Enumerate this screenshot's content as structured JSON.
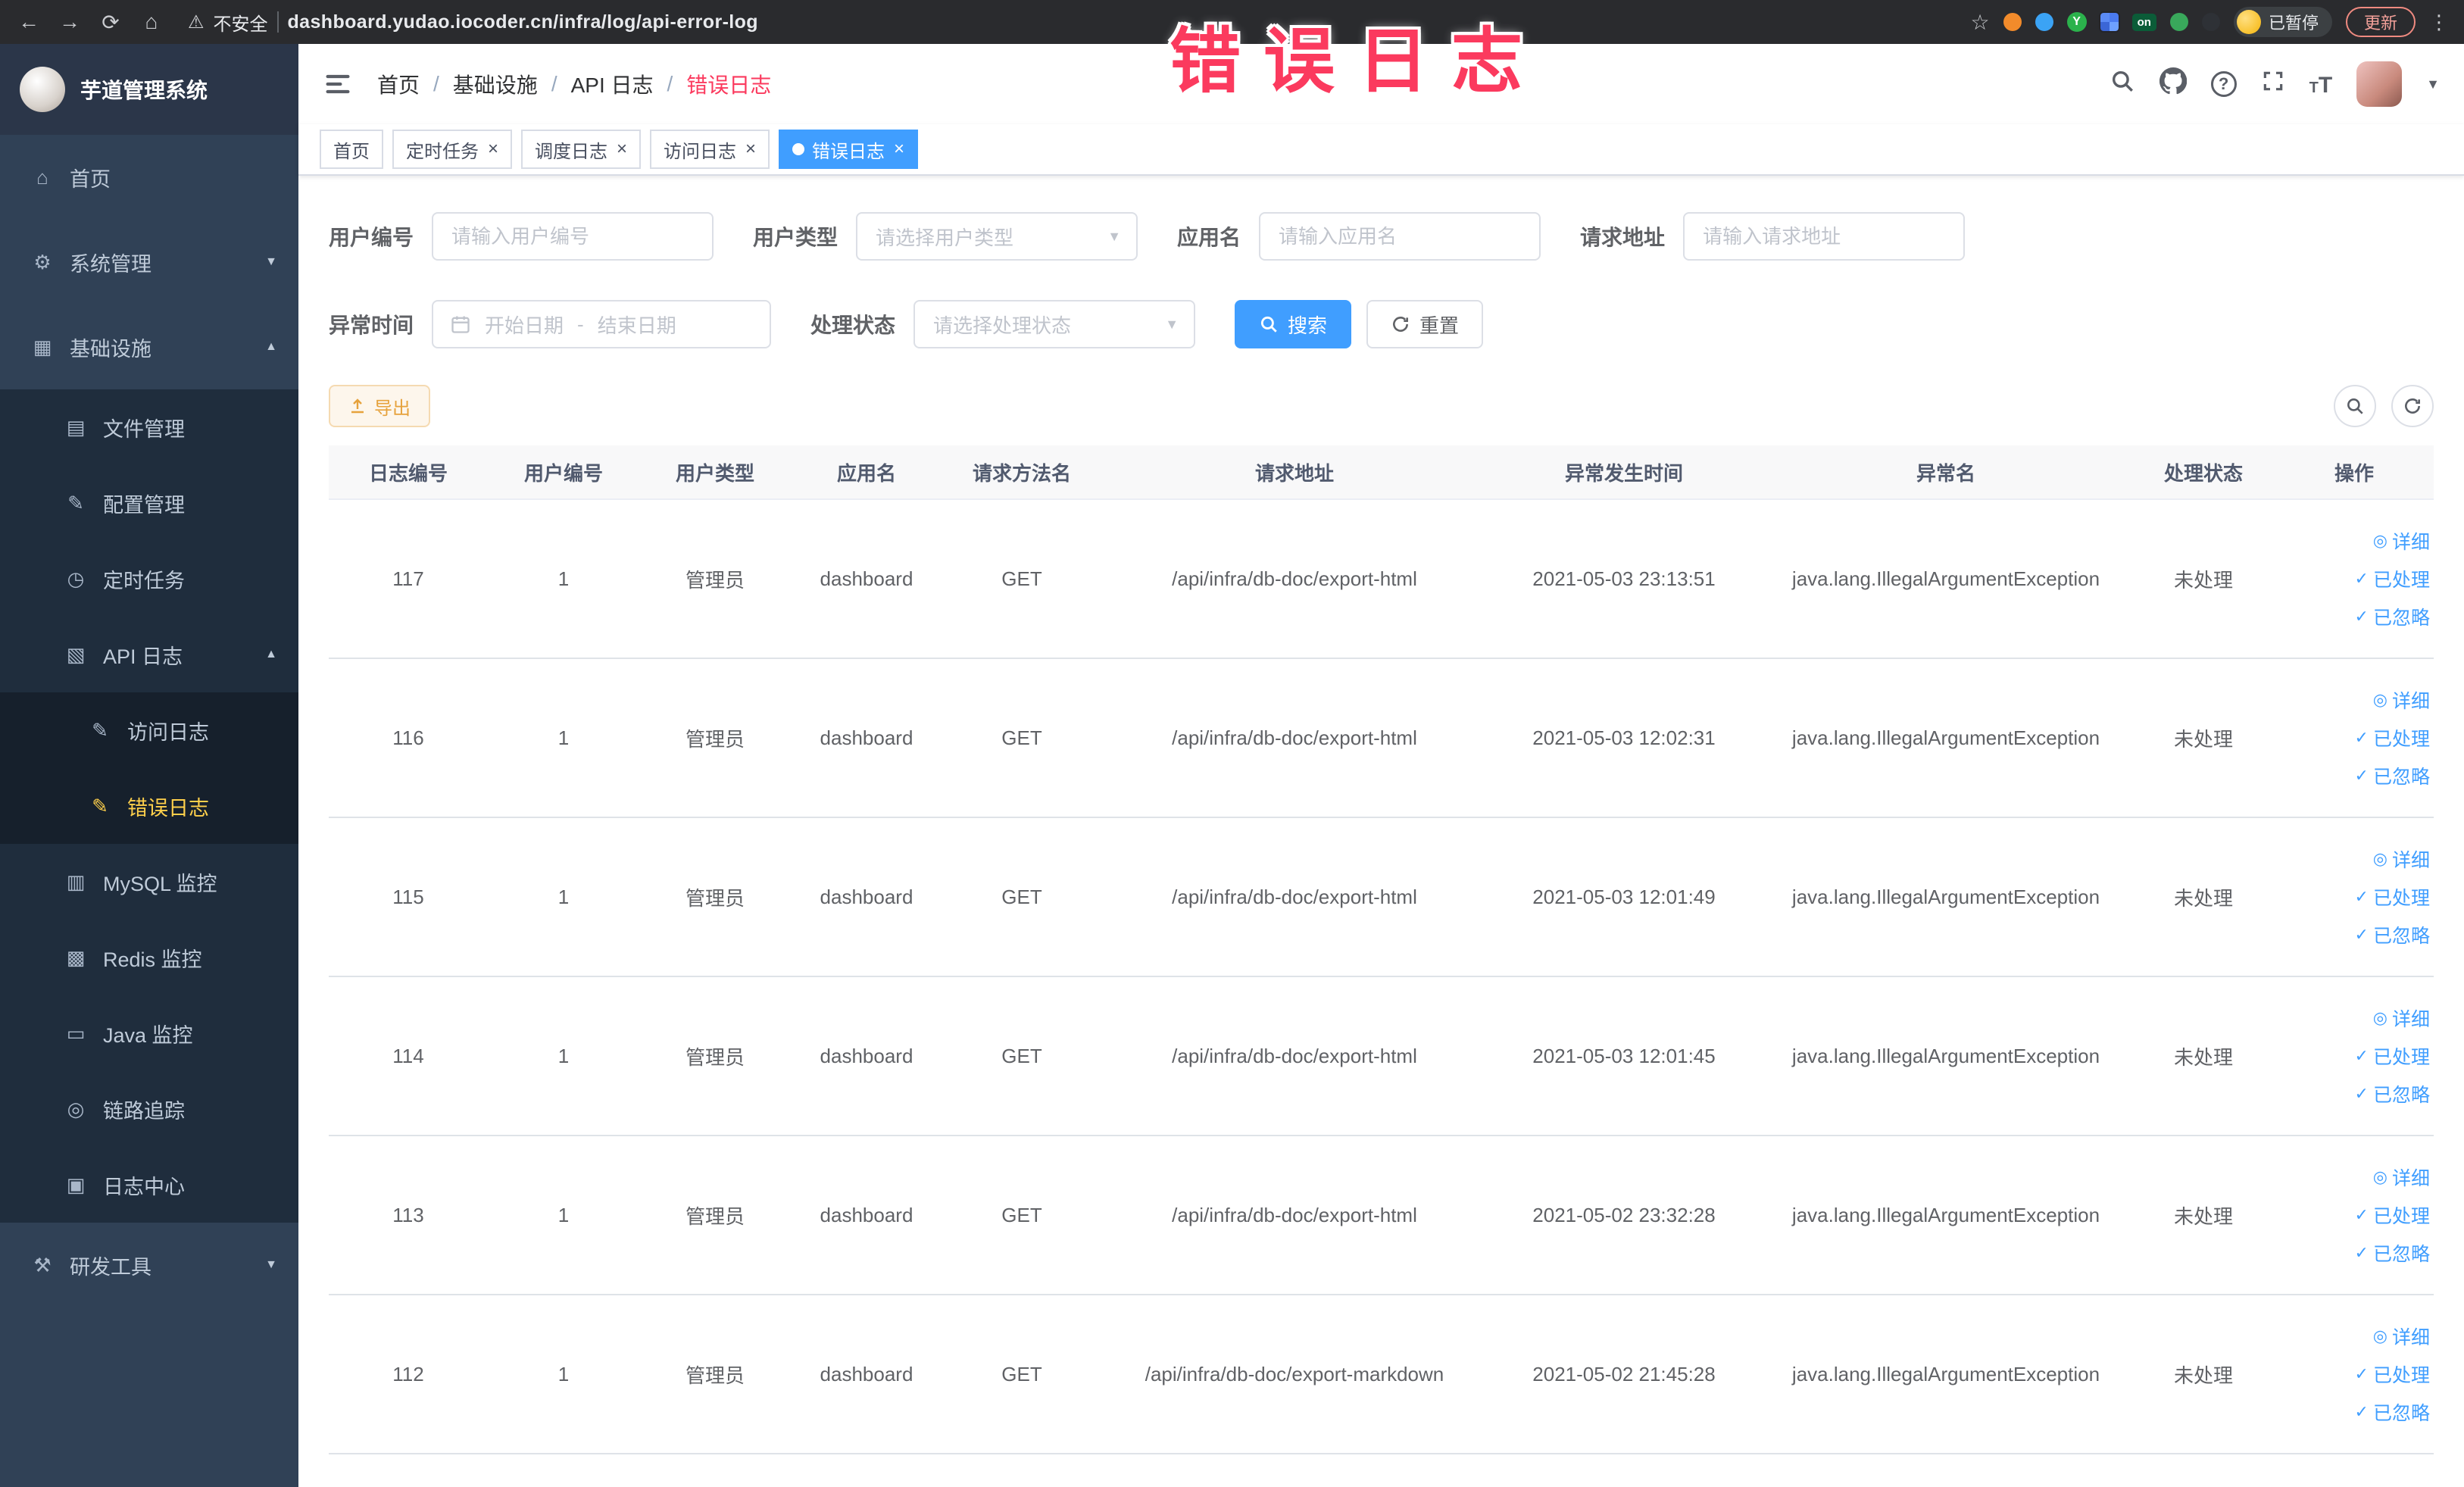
{
  "browser": {
    "security_label": "不安全",
    "url": "dashboard.yudao.iocoder.cn/infra/log/api-error-log",
    "profile_badge": "已暂停",
    "update_label": "更新",
    "extension_on_badge": "on",
    "extension_y_label": "Y"
  },
  "annotation": {
    "label": "错误日志"
  },
  "app": {
    "logo_title": "芋道管理系统"
  },
  "sidebar": {
    "items": [
      {
        "label": "首页"
      },
      {
        "label": "系统管理"
      },
      {
        "label": "基础设施"
      },
      {
        "label": "文件管理"
      },
      {
        "label": "配置管理"
      },
      {
        "label": "定时任务"
      },
      {
        "label": "API 日志"
      },
      {
        "label": "访问日志"
      },
      {
        "label": "错误日志"
      },
      {
        "label": "MySQL 监控"
      },
      {
        "label": "Redis 监控"
      },
      {
        "label": "Java 监控"
      },
      {
        "label": "链路追踪"
      },
      {
        "label": "日志中心"
      },
      {
        "label": "研发工具"
      }
    ]
  },
  "breadcrumb": {
    "separator": "/",
    "items": [
      {
        "label": "首页"
      },
      {
        "label": "基础设施"
      },
      {
        "label": "API 日志"
      },
      {
        "label": "错误日志"
      }
    ]
  },
  "tabs": [
    {
      "label": "首页"
    },
    {
      "label": "定时任务"
    },
    {
      "label": "调度日志"
    },
    {
      "label": "访问日志"
    },
    {
      "label": "错误日志"
    }
  ],
  "filters": {
    "user_id": {
      "label": "用户编号",
      "placeholder": "请输入用户编号"
    },
    "user_type": {
      "label": "用户类型",
      "placeholder": "请选择用户类型"
    },
    "app_name": {
      "label": "应用名",
      "placeholder": "请输入应用名"
    },
    "request_url": {
      "label": "请求地址",
      "placeholder": "请输入请求地址"
    },
    "exception_time": {
      "label": "异常时间",
      "start_placeholder": "开始日期",
      "separator": "-",
      "end_placeholder": "结束日期"
    },
    "process_status": {
      "label": "处理状态",
      "placeholder": "请选择处理状态"
    },
    "search_label": "搜索",
    "reset_label": "重置"
  },
  "toolbar": {
    "export_label": "导出"
  },
  "table": {
    "columns": [
      "日志编号",
      "用户编号",
      "用户类型",
      "应用名",
      "请求方法名",
      "请求地址",
      "异常发生时间",
      "异常名",
      "处理状态",
      "操作"
    ],
    "action_labels": [
      "详细",
      "已处理",
      "已忽略"
    ],
    "rows": [
      {
        "log_id": "117",
        "user_id": "1",
        "user_type": "管理员",
        "app_name": "dashboard",
        "method": "GET",
        "url": "/api/infra/db-doc/export-html",
        "time": "2021-05-03 23:13:51",
        "exception": "java.lang.IllegalArgumentException",
        "status": "未处理"
      },
      {
        "log_id": "116",
        "user_id": "1",
        "user_type": "管理员",
        "app_name": "dashboard",
        "method": "GET",
        "url": "/api/infra/db-doc/export-html",
        "time": "2021-05-03 12:02:31",
        "exception": "java.lang.IllegalArgumentException",
        "status": "未处理"
      },
      {
        "log_id": "115",
        "user_id": "1",
        "user_type": "管理员",
        "app_name": "dashboard",
        "method": "GET",
        "url": "/api/infra/db-doc/export-html",
        "time": "2021-05-03 12:01:49",
        "exception": "java.lang.IllegalArgumentException",
        "status": "未处理"
      },
      {
        "log_id": "114",
        "user_id": "1",
        "user_type": "管理员",
        "app_name": "dashboard",
        "method": "GET",
        "url": "/api/infra/db-doc/export-html",
        "time": "2021-05-03 12:01:45",
        "exception": "java.lang.IllegalArgumentException",
        "status": "未处理"
      },
      {
        "log_id": "113",
        "user_id": "1",
        "user_type": "管理员",
        "app_name": "dashboard",
        "method": "GET",
        "url": "/api/infra/db-doc/export-html",
        "time": "2021-05-02 23:32:28",
        "exception": "java.lang.IllegalArgumentException",
        "status": "未处理"
      },
      {
        "log_id": "112",
        "user_id": "1",
        "user_type": "管理员",
        "app_name": "dashboard",
        "method": "GET",
        "url": "/api/infra/db-doc/export-markdown",
        "time": "2021-05-02 21:45:28",
        "exception": "java.lang.IllegalArgumentException",
        "status": "未处理"
      }
    ]
  },
  "colors": {
    "primary": "#409eff",
    "sidebar_bg": "#304156",
    "submenu_bg": "#1f2d3d",
    "active_menu_text": "#ffd04b",
    "annotation_pink": "#fb3a5e",
    "warning_text": "#e6a23c"
  }
}
